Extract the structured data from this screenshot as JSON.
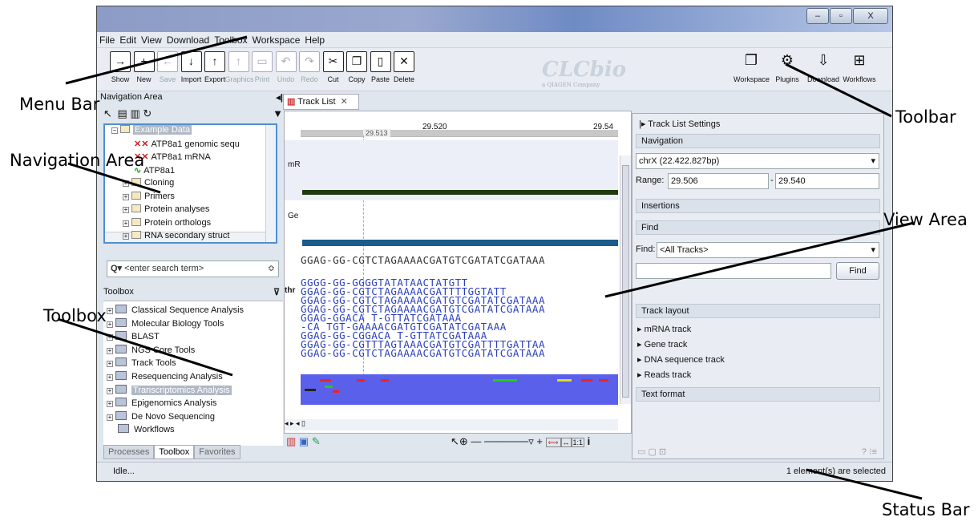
{
  "window": {
    "controls": {
      "minimize": "–",
      "maximize": "▫",
      "close": "X"
    },
    "menu": [
      "File",
      "Edit",
      "View",
      "Download",
      "Toolbox",
      "Workspace",
      "Help"
    ],
    "toolbar": [
      {
        "label": "Show",
        "icon": "show-icon",
        "glyph": "→",
        "enabled": true
      },
      {
        "label": "New",
        "icon": "new-icon",
        "glyph": "+",
        "enabled": true
      },
      {
        "label": "Save",
        "icon": "save-icon",
        "glyph": "←",
        "enabled": false
      },
      {
        "label": "Import",
        "icon": "import-icon",
        "glyph": "↓",
        "enabled": true
      },
      {
        "label": "Export",
        "icon": "export-icon",
        "glyph": "↑",
        "enabled": true
      },
      {
        "label": "Graphics",
        "icon": "graphics-icon",
        "glyph": "↑",
        "enabled": false
      },
      {
        "label": "Print",
        "icon": "print-icon",
        "glyph": "▭",
        "enabled": false
      },
      {
        "label": "Undo",
        "icon": "undo-icon",
        "glyph": "↶",
        "enabled": false
      },
      {
        "label": "Redo",
        "icon": "redo-icon",
        "glyph": "↷",
        "enabled": false
      },
      {
        "label": "Cut",
        "icon": "cut-icon",
        "glyph": "✂",
        "enabled": true
      },
      {
        "label": "Copy",
        "icon": "copy-icon",
        "glyph": "❐",
        "enabled": true
      },
      {
        "label": "Paste",
        "icon": "paste-icon",
        "glyph": "▯",
        "enabled": true
      },
      {
        "label": "Delete",
        "icon": "delete-icon",
        "glyph": "✕",
        "enabled": true
      }
    ],
    "toolbar_right": [
      {
        "label": "Workspace",
        "icon": "workspace-icon",
        "glyph": "❐"
      },
      {
        "label": "Plugins",
        "icon": "plugins-icon",
        "glyph": "⚙"
      },
      {
        "label": "Download",
        "icon": "download-icon",
        "glyph": "⇩"
      },
      {
        "label": "Workflows",
        "icon": "workflows-icon",
        "glyph": "⊞"
      }
    ],
    "logo": "CLCbio",
    "logo_sub": "a QIAGEN Company"
  },
  "navigation": {
    "title": "Navigation Area",
    "tree": [
      {
        "label": "Example Data",
        "type": "folder",
        "selected": true
      },
      {
        "label": "ATP8a1 genomic sequ",
        "type": "seq"
      },
      {
        "label": "ATP8a1 mRNA",
        "type": "seq"
      },
      {
        "label": "ATP8a1",
        "type": "track"
      },
      {
        "label": "Cloning",
        "type": "folder"
      },
      {
        "label": "Primers",
        "type": "folder"
      },
      {
        "label": "Protein analyses",
        "type": "folder"
      },
      {
        "label": "Protein orthologs",
        "type": "folder"
      },
      {
        "label": "RNA secondary struct",
        "type": "folder"
      }
    ],
    "search_placeholder": "<enter search term>"
  },
  "toolbox": {
    "title": "Toolbox",
    "items": [
      "Classical Sequence Analysis",
      "Molecular Biology Tools",
      "BLAST",
      "NGS Core Tools",
      "Track Tools",
      "Resequencing Analysis",
      "Transcriptomics Analysis",
      "Epigenomics Analysis",
      "De Novo Sequencing",
      "Workflows"
    ],
    "selected": "Transcriptomics Analysis",
    "tabs": [
      "Processes",
      "Toolbox",
      "Favorites"
    ],
    "active_tab": "Toolbox"
  },
  "view": {
    "tab": "Track List",
    "ruler": [
      "29.520",
      "29.54"
    ],
    "ruler_marker": "29.513",
    "track_labels": [
      "mR",
      "Ge"
    ],
    "reference": "GGAG-GG-CGTCTAGAAAACGATGTCGATATCGATAAA",
    "reads_label": "thr",
    "reads": [
      "GGGG-GG-GGGGTATATAACTATGTT",
      "GGAG-GG-CGTCTAGAAAACGATTTTGGTATT",
      "GGAG-GG-CGTCTAGAAAACGATGTCGATATCGATAAA",
      "GGAG-GG-CGTCTAGAAAACGATGTCGATATCGATAAA",
      "GGAG-GGACA               T-GTTATCGATAAA",
      "-CA       TGT-GAAAACGATGTCGATATCGATAAA",
      "GGAG-GG-CGGACA           T-GTTATCGATAAA",
      "GGAG-GG-CGTTTAGTAAACGATGTCGATTTTGATTAA",
      "GGAG-GG-CGTCTAGAAAACGATGTCGATATCGATAAA"
    ],
    "zoom_one": "1:1"
  },
  "settings": {
    "title": "Track List Settings",
    "navigation": "Navigation",
    "chromosome": "chrX (22.422.827bp)",
    "range_label": "Range:",
    "range_from": "29.506",
    "range_to": "29.540",
    "insertions": "Insertions",
    "find_section": "Find",
    "find_label": "Find:",
    "find_scope": "<All Tracks>",
    "find_button": "Find",
    "track_layout": "Track layout",
    "tracks": [
      "mRNA track",
      "Gene track",
      "DNA sequence track",
      "Reads track"
    ],
    "text_format": "Text format"
  },
  "status": {
    "left": "Idle...",
    "right": "1 element(s) are selected"
  },
  "annotations": {
    "menu_bar": "Menu Bar",
    "navigation_area": "Navigation Area",
    "toolbox": "Toolbox",
    "toolbar": "Toolbar",
    "view_area": "View Area",
    "status_bar": "Status Bar"
  },
  "colors": {
    "accent": "#4f8fd0",
    "reads_blue": "#2b3fbd",
    "track_teal": "#1c5c8c",
    "coverage": "#5a60ea"
  }
}
